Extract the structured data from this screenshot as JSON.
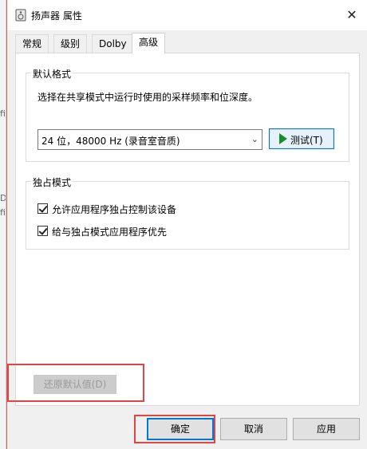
{
  "dialog": {
    "title": "扬声器 属性",
    "close_symbol": "✕"
  },
  "background_window": {
    "fragments": [
      "fi",
      "Du",
      "fi"
    ]
  },
  "tabs": [
    {
      "label": "常规",
      "active": false
    },
    {
      "label": "级别",
      "active": false
    },
    {
      "label": "Dolby",
      "active": false
    },
    {
      "label": "高级",
      "active": true
    }
  ],
  "default_format": {
    "group_title": "默认格式",
    "description": "选择在共享模式中运行时使用的采样频率和位深度。",
    "selected_format": "24 位，48000 Hz (录音室音质)",
    "test_button_label": "测试(T)"
  },
  "exclusive_mode": {
    "group_title": "独占模式",
    "options": [
      {
        "label": "允许应用程序独占控制该设备",
        "checked": true
      },
      {
        "label": "给与独占模式应用程序优先",
        "checked": true
      }
    ]
  },
  "restore_defaults_label": "还原默认值(D)",
  "buttons": {
    "ok": "确定",
    "cancel": "取消",
    "apply": "应用"
  },
  "colors": {
    "highlight": "#e04545",
    "focus_blue": "#0078d7",
    "play_green": "#1a8c2a"
  },
  "icons": {
    "title_icon": "speaker-icon",
    "dropdown_arrow": "chevron-down-icon",
    "test_play": "play-icon"
  }
}
